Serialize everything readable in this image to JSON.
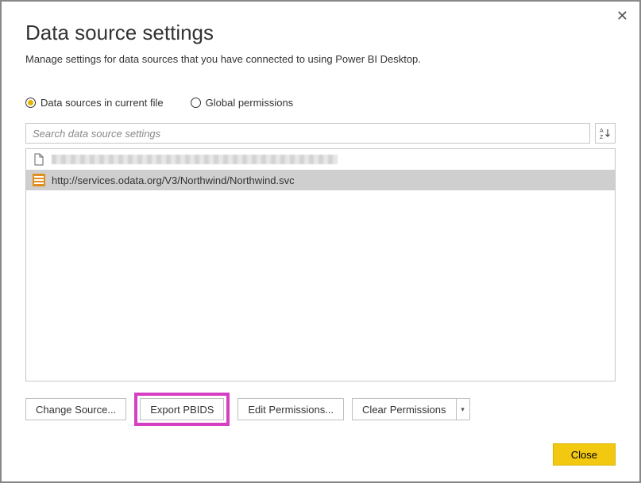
{
  "close_glyph": "✕",
  "title": "Data source settings",
  "subtitle": "Manage settings for data sources that you have connected to using Power BI Desktop.",
  "radios": {
    "current": "Data sources in current file",
    "global": "Global permissions"
  },
  "search": {
    "placeholder": "Search data source settings"
  },
  "sort_label": "A↓Z",
  "list": {
    "row1_label": "",
    "row2_label": "http://services.odata.org/V3/Northwind/Northwind.svc"
  },
  "buttons": {
    "change_source": "Change Source...",
    "export_pbids": "Export PBIDS",
    "edit_permissions": "Edit Permissions...",
    "clear_permissions": "Clear Permissions"
  },
  "footer": {
    "close": "Close"
  }
}
